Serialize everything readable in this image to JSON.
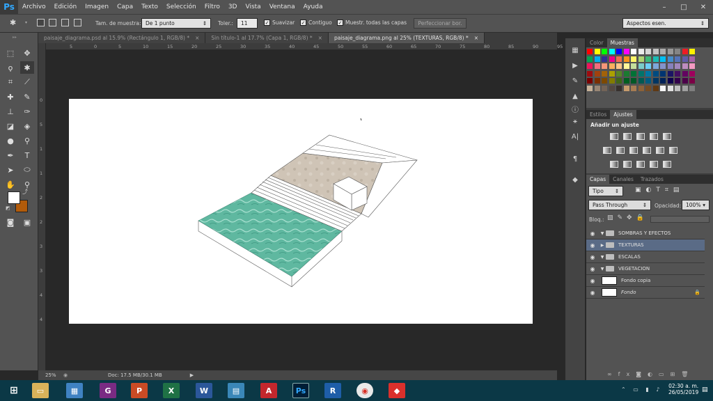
{
  "menubar": {
    "logo": "Ps",
    "items": [
      "Archivo",
      "Edición",
      "Imagen",
      "Capa",
      "Texto",
      "Selección",
      "Filtro",
      "3D",
      "Vista",
      "Ventana",
      "Ayuda"
    ],
    "min": "–",
    "max": "□",
    "close": "✕"
  },
  "options": {
    "sample_label": "Tam. de muestra:",
    "sample_value": "De 1 punto",
    "tol_label": "Toler.:",
    "tol_value": "11",
    "smooth": "Suavizar",
    "contiguous": "Contiguo",
    "sample_all": "Muestr. todas las capas",
    "refine": "Perfeccionar bor.",
    "workspace": "Aspectos esen."
  },
  "tabs": [
    {
      "label": "paisaje_diagrama.psd al 15.9% (Rectángulo 1, RGB/8) *",
      "close": "×"
    },
    {
      "label": "Sin título-1 al 17.7% (Capa 1, RGB/8) *",
      "close": "×"
    },
    {
      "label": "paisaje_diagrama.png al 25% (TEXTURAS, RGB/8) *",
      "close": "×"
    }
  ],
  "ruler_h": [
    "5",
    "0",
    "5",
    "10",
    "15",
    "20",
    "25",
    "30",
    "35",
    "40",
    "45",
    "50",
    "55",
    "60",
    "65",
    "70",
    "75",
    "80",
    "85",
    "90",
    "95"
  ],
  "ruler_v": [
    "0",
    "5",
    "1",
    "1",
    "2",
    "2",
    "3",
    "3",
    "4",
    "4"
  ],
  "status": {
    "zoom": "25%",
    "doc": "Doc: 17.5 MB/30.1 MB"
  },
  "panels": {
    "color_tab": "Color",
    "swatches_tab": "Muestras",
    "styles_tab": "Estilos",
    "adjust_tab": "Ajustes",
    "adjust_title": "Añadir un ajuste",
    "layers_tab": "Capas",
    "channels_tab": "Canales",
    "paths_tab": "Trazados",
    "kind": "Tipo",
    "blend": "Pass Through",
    "opacity_label": "Opacidad:",
    "opacity": "100%",
    "lock": "Bloq.:"
  },
  "layers": [
    {
      "name": "SOMBRAS Y EFECTOS",
      "type": "group",
      "open": true
    },
    {
      "name": "TEXTURAS",
      "type": "group",
      "open": false
    },
    {
      "name": "ESCALAS",
      "type": "group",
      "open": true
    },
    {
      "name": "VEGETACION",
      "type": "group",
      "open": true
    },
    {
      "name": "Fondo copia",
      "type": "layer"
    },
    {
      "name": "Fondo",
      "type": "layer",
      "locked": true
    }
  ],
  "taskbar": {
    "time": "02:30 a. m.",
    "date": "26/05/2019"
  },
  "colors": {
    "accent": "#31a8ff",
    "selected_layer": "#5a6b86",
    "fg": "#ffffff",
    "bg": "#b25b0a",
    "water": "#5fb8a0",
    "stone": "#cfc4b6"
  }
}
